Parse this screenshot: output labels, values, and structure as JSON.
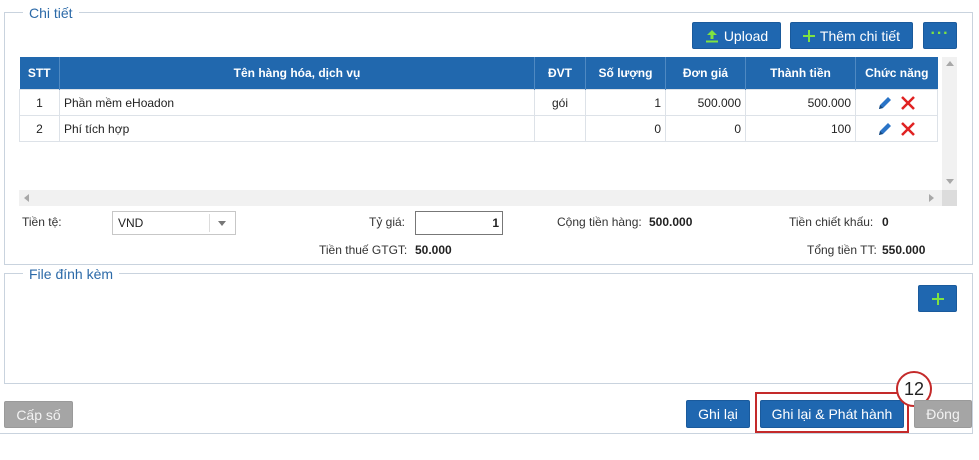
{
  "details": {
    "legend": "Chi tiết",
    "upload_label": "Upload",
    "add_detail_label": "Thêm chi tiết",
    "more_label": "···",
    "table": {
      "headers": [
        "STT",
        "Tên hàng hóa, dịch vụ",
        "ĐVT",
        "Số lượng",
        "Đơn giá",
        "Thành tiền",
        "Chức năng"
      ],
      "rows": [
        {
          "stt": "1",
          "name": "Phần mềm eHoadon",
          "unit": "gói",
          "qty": "1",
          "price": "500.000",
          "amount": "500.000"
        },
        {
          "stt": "2",
          "name": "Phí tích hợp",
          "unit": "",
          "qty": "0",
          "price": "0",
          "amount": "100"
        }
      ]
    },
    "summary": {
      "currency_label": "Tiền tệ:",
      "currency_value": "VND",
      "rate_label": "Tỷ giá:",
      "rate_value": "1",
      "goods_total_label": "Cộng tiền hàng:",
      "goods_total_value": "500.000",
      "discount_label": "Tiền chiết khấu:",
      "discount_value": "0",
      "vat_label": "Tiền thuế GTGT:",
      "vat_value": "50.000",
      "grand_total_label": "Tổng tiền TT:",
      "grand_total_value": "550.000"
    }
  },
  "attachments": {
    "legend": "File đính kèm"
  },
  "footer": {
    "issue_number_label": "Cấp số",
    "save_label": "Ghi lại",
    "save_publish_label": "Ghi lại & Phát hành",
    "close_label": "Đóng",
    "step_badge": "12"
  },
  "colors": {
    "primary": "#1f67b0",
    "header": "#2168ae",
    "highlight": "#c42a2a",
    "disabled": "#a5a5a5",
    "edit_icon": "#2a74c7",
    "delete_icon": "#e02222",
    "plus_icon": "#7fe341"
  },
  "icons": [
    "upload-icon",
    "plus-icon",
    "ellipsis-icon",
    "pencil-icon",
    "delete-x-icon",
    "dropdown-arrow-icon"
  ]
}
